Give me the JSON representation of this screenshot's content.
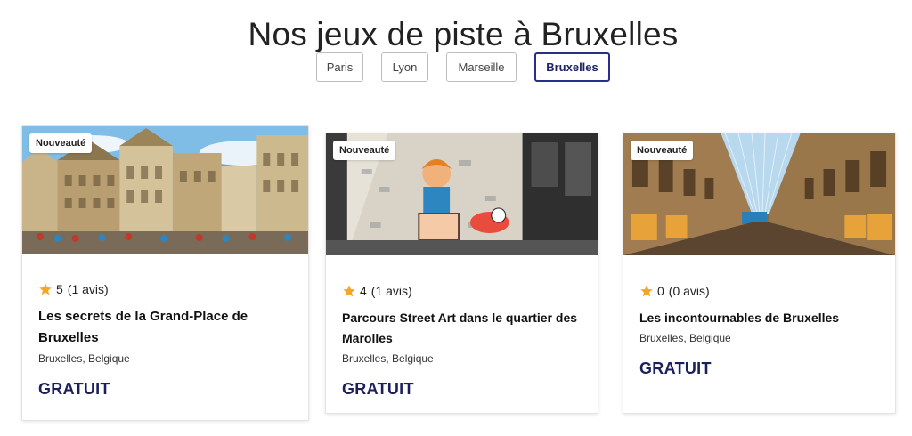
{
  "page": {
    "title": "Nos jeux de piste à Bruxelles"
  },
  "cities": [
    {
      "label": "Paris",
      "active": false
    },
    {
      "label": "Lyon",
      "active": false
    },
    {
      "label": "Marseille",
      "active": false
    },
    {
      "label": "Bruxelles",
      "active": true
    }
  ],
  "cards": [
    {
      "badge": "Nouveauté",
      "image": "grand-place-photo",
      "rating": "5",
      "reviews": "(1 avis)",
      "title": "Les secrets de la Grand-Place de Bruxelles",
      "location": "Bruxelles, Belgique",
      "price": "GRATUIT"
    },
    {
      "badge": "Nouveauté",
      "image": "street-art-mural-photo",
      "rating": "4",
      "reviews": "(1 avis)",
      "title": "Parcours Street Art dans le quartier des Marolles",
      "location": "Bruxelles, Belgique",
      "price": "GRATUIT"
    },
    {
      "badge": "Nouveauté",
      "image": "galeries-royales-photo",
      "rating": "0",
      "reviews": "(0 avis)",
      "title": "Les incontournables de Bruxelles",
      "location": "Bruxelles, Belgique",
      "price": "GRATUIT"
    }
  ],
  "colors": {
    "accent": "#2b2d8c",
    "price": "#1b1f5c",
    "star": "#f5a623"
  }
}
